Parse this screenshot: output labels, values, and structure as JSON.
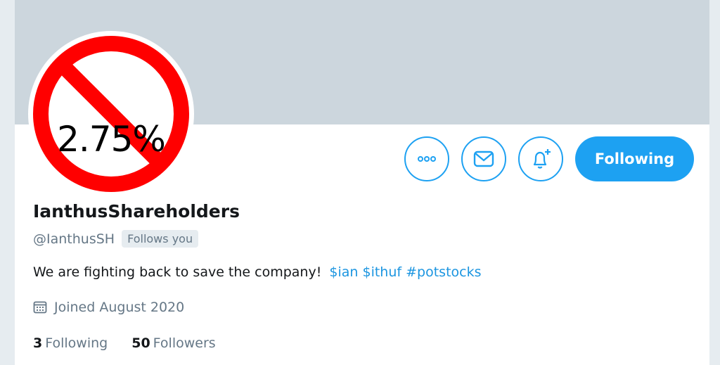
{
  "profile": {
    "avatar_text": "2.75%",
    "name": "IanthusShareholders",
    "handle": "@IanthusSH",
    "follows_you": "Follows you",
    "bio": "We are fighting back to save the company!",
    "bio_tags": "$ian $ithuf #potstocks",
    "joined": "Joined August 2020",
    "following_count": "3",
    "following_label": "Following",
    "followers_count": "50",
    "followers_label": "Followers"
  },
  "actions": {
    "more_icon": "more-dots-icon",
    "message_icon": "envelope-icon",
    "notify_icon": "bell-plus-icon",
    "follow_label": "Following"
  },
  "colors": {
    "accent": "#1da1f2",
    "banner": "#ccd6dd",
    "prohibition_red": "#ff0000"
  }
}
